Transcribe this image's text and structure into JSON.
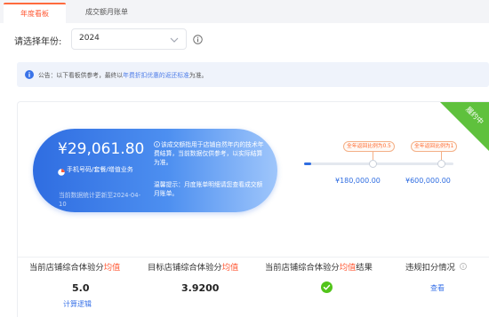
{
  "tabs": [
    {
      "label": "年度看板"
    },
    {
      "label": "成交额月账单"
    }
  ],
  "year_filter": {
    "label": "请选择年份:",
    "value": "2024"
  },
  "notice": {
    "text_prefix": "公告：以下看板供参考，最终以",
    "link_text": "年费折扣优惠的返还标准",
    "text_suffix": "为准。"
  },
  "ribbon": {
    "label": "履约中"
  },
  "summary": {
    "amount": "¥29,061.80",
    "metric_label": "手机号码/套餐/增值业务",
    "update_text": "当前数据统计更新至2024-04-10",
    "description": "该成交额指用于店铺自然年内的技术年费结算，当前数据仅供参考，以实际结算为准。",
    "tip": "温馨提示：月度账单明细请您查看成交额月账单。"
  },
  "goals": [
    {
      "flag": "全年返回比例为0.5",
      "value": "¥180,000.00"
    },
    {
      "flag": "全年返回比例为1",
      "value": "¥600,000.00"
    }
  ],
  "progress": {
    "fraction": 0.05
  },
  "metrics": [
    {
      "label_prefix": "当前店铺综合体验分",
      "label_highlight": "均值",
      "label_suffix": "",
      "value": "5.0",
      "link": "计算逻辑"
    },
    {
      "label_prefix": "目标店铺综合体验分",
      "label_highlight": "均值",
      "label_suffix": "",
      "value": "3.9200"
    },
    {
      "label_prefix": "当前店铺综合体验分",
      "label_highlight": "均值",
      "label_suffix": "结果",
      "status": "check-icon"
    },
    {
      "label_prefix": "违规扣分情况",
      "link": "查看"
    }
  ],
  "colors": {
    "accent": "#ff5a36",
    "primary": "#2f6de1",
    "ribbon": "#5fc13d",
    "success": "#52c41a"
  }
}
